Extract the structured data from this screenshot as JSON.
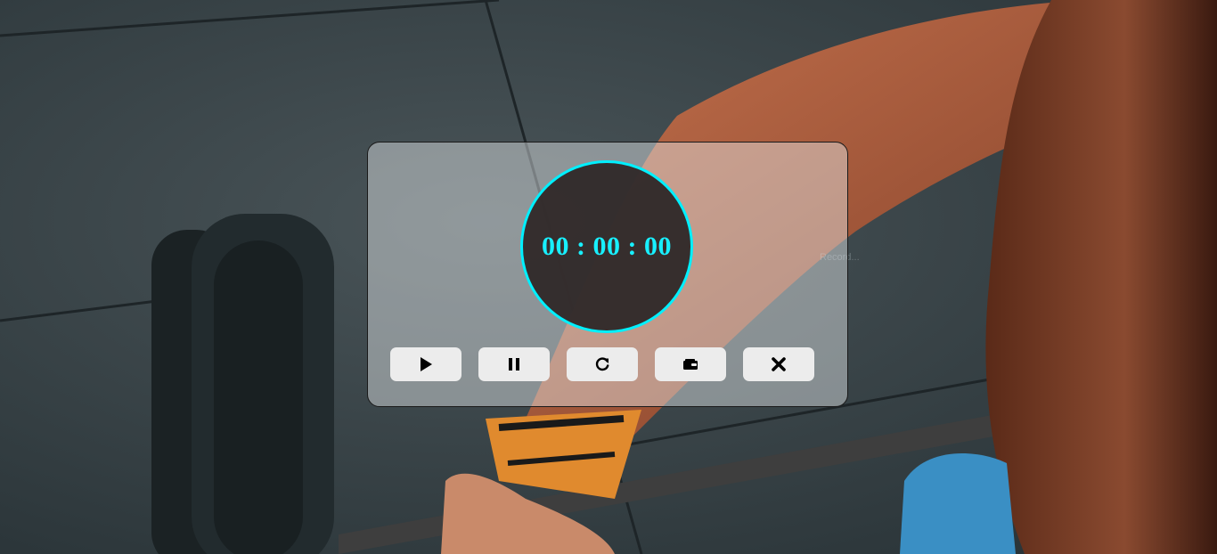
{
  "stopwatch": {
    "time_display": "00 : 00 : 00",
    "accent_color": "#00f0ff"
  },
  "background": {
    "faint_text": "Record...",
    "description_icons": [
      "barbell-plate",
      "barbell-bar",
      "athlete-arm",
      "wrist-wrap",
      "sneaker"
    ]
  },
  "controls": [
    {
      "name": "start-button",
      "icon": "play-icon"
    },
    {
      "name": "pause-button",
      "icon": "pause-icon"
    },
    {
      "name": "reset-button",
      "icon": "reload-icon"
    },
    {
      "name": "record-button",
      "icon": "wallet-icon"
    },
    {
      "name": "close-button",
      "icon": "close-icon"
    }
  ]
}
